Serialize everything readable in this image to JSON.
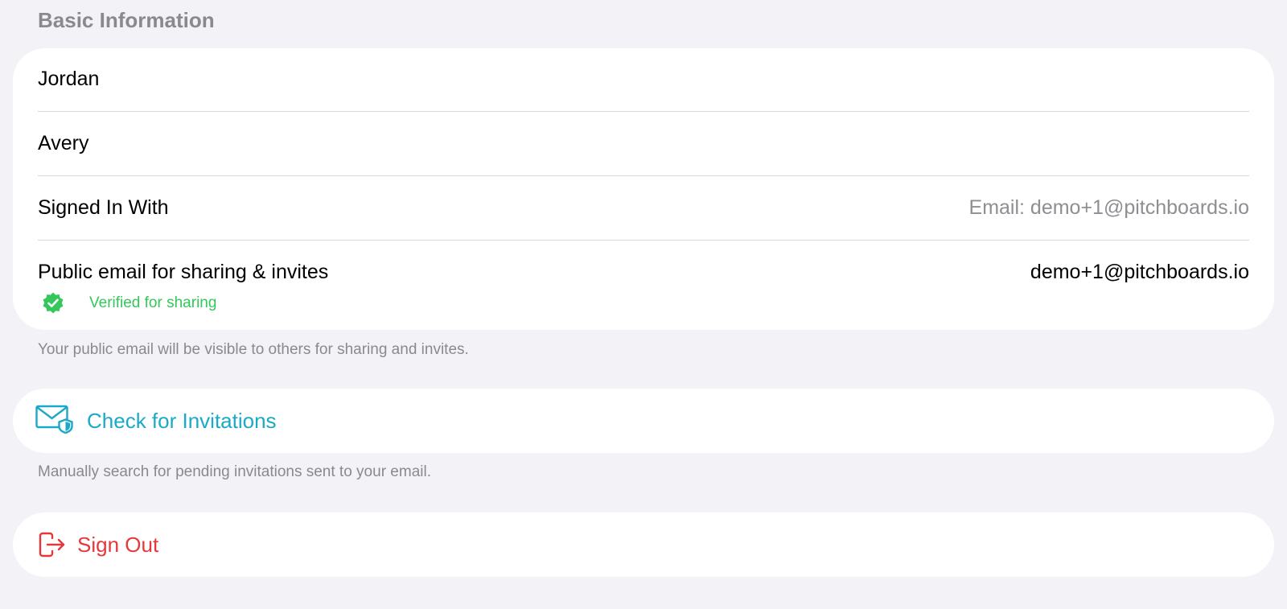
{
  "section": {
    "title": "Basic Information"
  },
  "basic_info": {
    "first_name": "Jordan",
    "last_name": "Avery",
    "signed_in_label": "Signed In With",
    "signed_in_value": "Email: demo+1@pitchboards.io",
    "public_email_label": "Public email for sharing & invites",
    "public_email_value": "demo+1@pitchboards.io",
    "verified_text": "Verified for sharing",
    "verified_icon": "verified-badge-icon"
  },
  "public_email_note": "Your public email will be visible to others for sharing and invites.",
  "invitations": {
    "label": "Check for Invitations",
    "icon": "envelope-shield-icon",
    "note": "Manually search for pending invitations sent to your email."
  },
  "sign_out": {
    "label": "Sign Out",
    "icon": "sign-out-icon"
  },
  "colors": {
    "background": "#f2f2f7",
    "card": "#ffffff",
    "accent_teal": "#1aa9c9",
    "destructive_red": "#e5383b",
    "verified_green": "#34c759",
    "secondary_text": "#8e8e93"
  }
}
